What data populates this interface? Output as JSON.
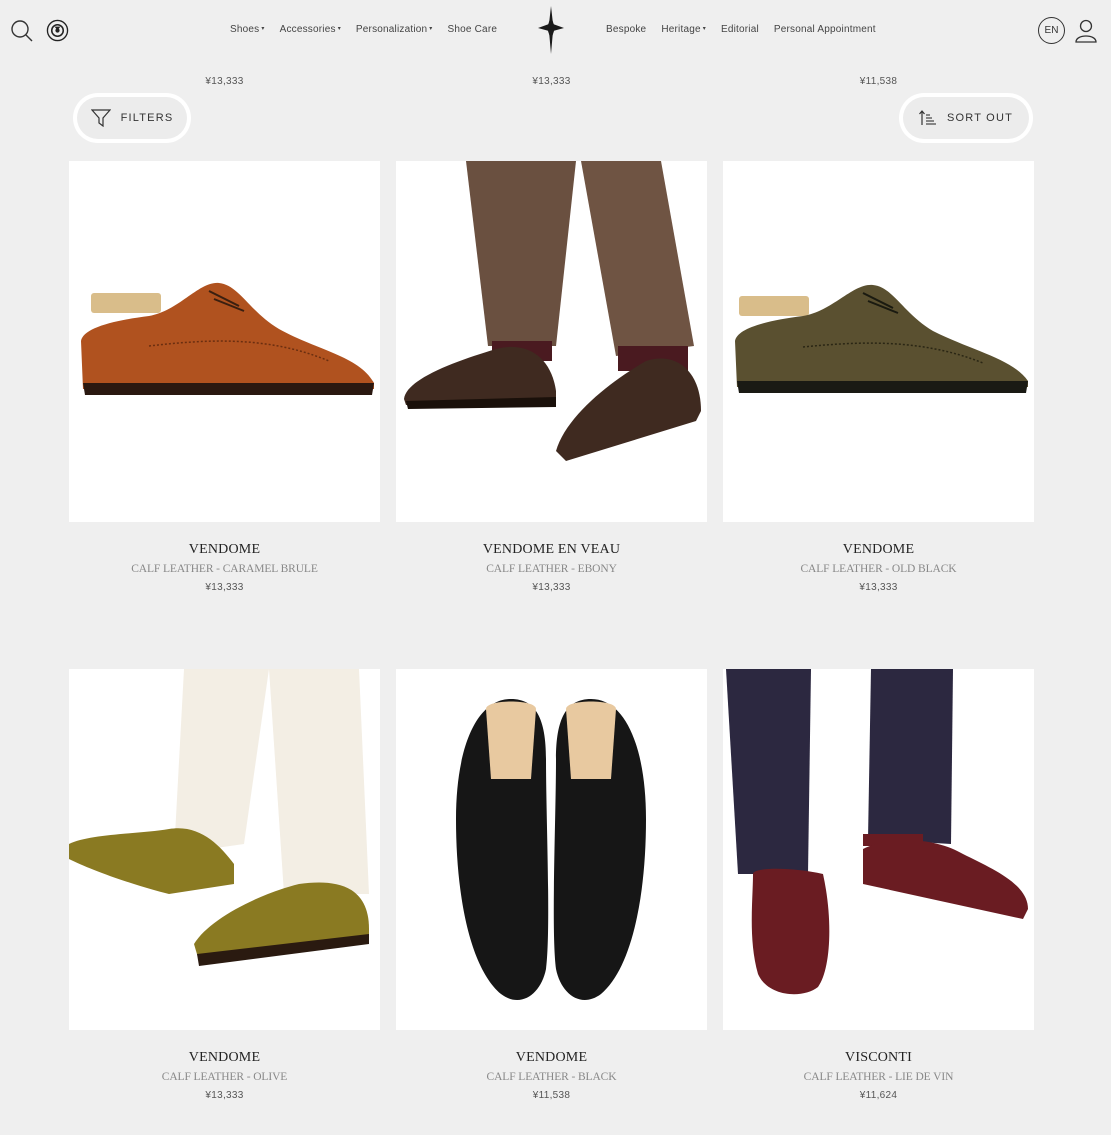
{
  "header": {
    "nav_left": [
      {
        "label": "Shoes",
        "caret": true
      },
      {
        "label": "Accessories",
        "caret": true
      },
      {
        "label": "Personalization",
        "caret": true
      },
      {
        "label": "Shoe Care",
        "caret": false
      }
    ],
    "nav_right": [
      {
        "label": "Bespoke",
        "caret": false
      },
      {
        "label": "Heritage",
        "caret": true
      },
      {
        "label": "Editorial",
        "caret": false
      },
      {
        "label": "Personal Appointment",
        "caret": false
      }
    ],
    "caret_glyph": "▾",
    "language": "EN"
  },
  "top_prices": [
    "¥13,333",
    "¥13,333",
    "¥11,538"
  ],
  "toolbar": {
    "filters_label": "FILTERS",
    "sort_label": "SORT OUT"
  },
  "products": [
    {
      "name": "VENDOME",
      "material": "CALF LEATHER - CARAMEL BRULE",
      "price": "¥13,333",
      "shoe_color": "#b0521f"
    },
    {
      "name": "VENDOME EN VEAU",
      "material": "CALF LEATHER - EBONY",
      "price": "¥13,333",
      "shoe_color": "#3f2a20"
    },
    {
      "name": "VENDOME",
      "material": "CALF LEATHER - OLD BLACK",
      "price": "¥13,333",
      "shoe_color": "#5a5030"
    },
    {
      "name": "VENDOME",
      "material": "CALF LEATHER - OLIVE",
      "price": "¥13,333",
      "shoe_color": "#8a7a22"
    },
    {
      "name": "VENDOME",
      "material": "CALF LEATHER - BLACK",
      "price": "¥11,538",
      "shoe_color": "#161616"
    },
    {
      "name": "VISCONTI",
      "material": "CALF LEATHER - LIE DE VIN",
      "price": "¥11,624",
      "shoe_color": "#6a1c22"
    }
  ]
}
